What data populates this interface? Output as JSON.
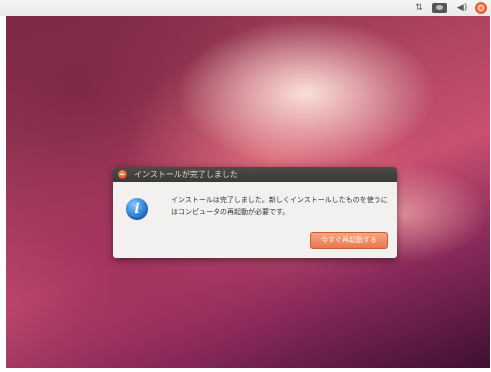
{
  "top_panel": {
    "indicators": {
      "network_icon": "network-icon",
      "mail_icon": "mail-icon",
      "sound_icon": "sound-icon",
      "power_icon": "power-icon"
    }
  },
  "dialog": {
    "title": "インストールが完了しました",
    "icon": "info-icon",
    "icon_glyph": "i",
    "message": "インストールは完了しました。新しくインストールしたものを使うにはコンピュータの再起動が必要です。",
    "restart_label": "今すぐ再起動する",
    "colors": {
      "titlebar": "#3f3d3a",
      "close_button": "#e0461d",
      "accent_button": "#ec8457",
      "info_icon": "#1f6fc9"
    }
  }
}
